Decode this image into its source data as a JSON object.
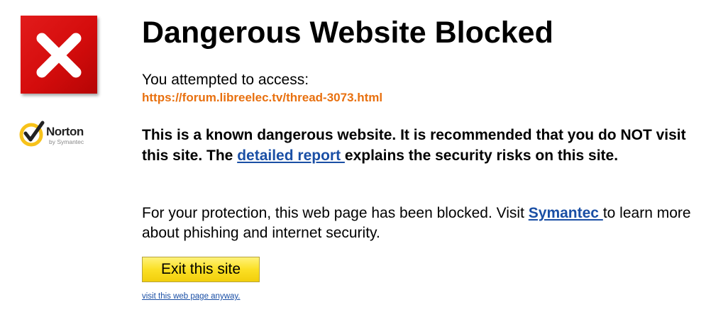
{
  "page": {
    "title": "Dangerous Website Blocked",
    "attempt_label": "You attempted to access:",
    "blocked_url": "https://forum.libreelec.tv/thread-3073.html",
    "warning": {
      "text_before_link": "This is a known dangerous website. It is recommended that you do NOT visit this site. The ",
      "link_label": "detailed report ",
      "text_after_link": "explains the security risks on this site."
    },
    "protection": {
      "text_before_link": "For your protection, this web page has been blocked. Visit ",
      "link_label": "Symantec ",
      "text_after_link": "to learn more about phishing and internet security."
    },
    "exit_button_label": "Exit this site",
    "visit_anyway_label": "visit this web page anyway."
  },
  "logo": {
    "brand": "Norton",
    "sub": "by Symantec",
    "icon": "norton-checkmark-icon"
  },
  "icons": {
    "blocked": "red-x-icon"
  },
  "colors": {
    "blocked_red": "#d40c0c",
    "url_orange": "#e8700f",
    "link_blue": "#1a4fa5",
    "button_yellow": "#fbe025",
    "norton_yellow": "#f7c21a"
  }
}
